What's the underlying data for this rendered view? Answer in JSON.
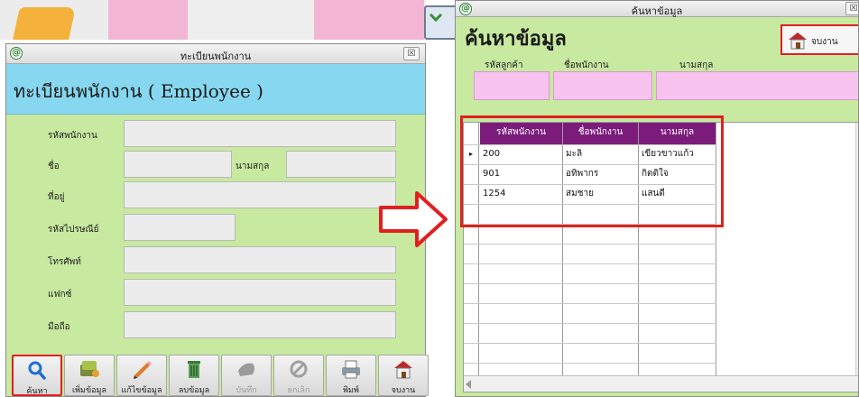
{
  "left_window": {
    "title": "ทะเบียนพนักงาน",
    "close_glyph": "☒",
    "header": "ทะเบียนพนักงาน ( Employee )",
    "fields": {
      "employee_id": "รหัสพนักงาน",
      "first_name": "ชื่อ",
      "last_name": "นามสกุล",
      "address": "ที่อยู่",
      "postal_code": "รหัสไปรษณีย์",
      "phone": "โทรศัพท์",
      "fax": "แฟกซ์",
      "mobile": "มือถือ"
    },
    "toolbar": [
      {
        "label": "ค้นหา",
        "icon": "search-icon",
        "enabled": true
      },
      {
        "label": "เพิ่มข้อมูล",
        "icon": "add-data-icon",
        "enabled": true
      },
      {
        "label": "แก้ไขข้อมูล",
        "icon": "pencil-icon",
        "enabled": true
      },
      {
        "label": "ลบข้อมูล",
        "icon": "trash-icon",
        "enabled": true
      },
      {
        "label": "บันทึก",
        "icon": "save-icon",
        "enabled": false
      },
      {
        "label": "ยกเลิก",
        "icon": "cancel-icon",
        "enabled": false
      },
      {
        "label": "พิมพ์",
        "icon": "printer-icon",
        "enabled": true
      },
      {
        "label": "จบงาน",
        "icon": "house-exit-icon",
        "enabled": true
      }
    ]
  },
  "right_window": {
    "title": "ค้นหาข้อมูล",
    "heading": "ค้นหาข้อมูล",
    "exit_label": "จบงาน",
    "filters": {
      "customer_id": "รหัสลูกค้า",
      "employee_name": "ชื่อพนักงาน",
      "last_name": "นามสกุล"
    },
    "grid": {
      "columns": [
        "รหัสพนักงาน",
        "ชื่อพนักงาน",
        "นามสกุล"
      ],
      "rows": [
        [
          "200",
          "มะลิ",
          "เขียวขาวแก้ว"
        ],
        [
          "901",
          "อทิพากร",
          "กิตติใจ"
        ],
        [
          "1254",
          "สมชาย",
          "แสนดี"
        ]
      ],
      "selected_row_marker": "▸"
    }
  },
  "app_icon_glyph": "@",
  "colors": {
    "form_background": "#c8e9a0",
    "header_band": "#86d7ef",
    "grid_header": "#7b1c7b",
    "filter_input": "#f7c3ee",
    "highlight": "#e02020"
  }
}
